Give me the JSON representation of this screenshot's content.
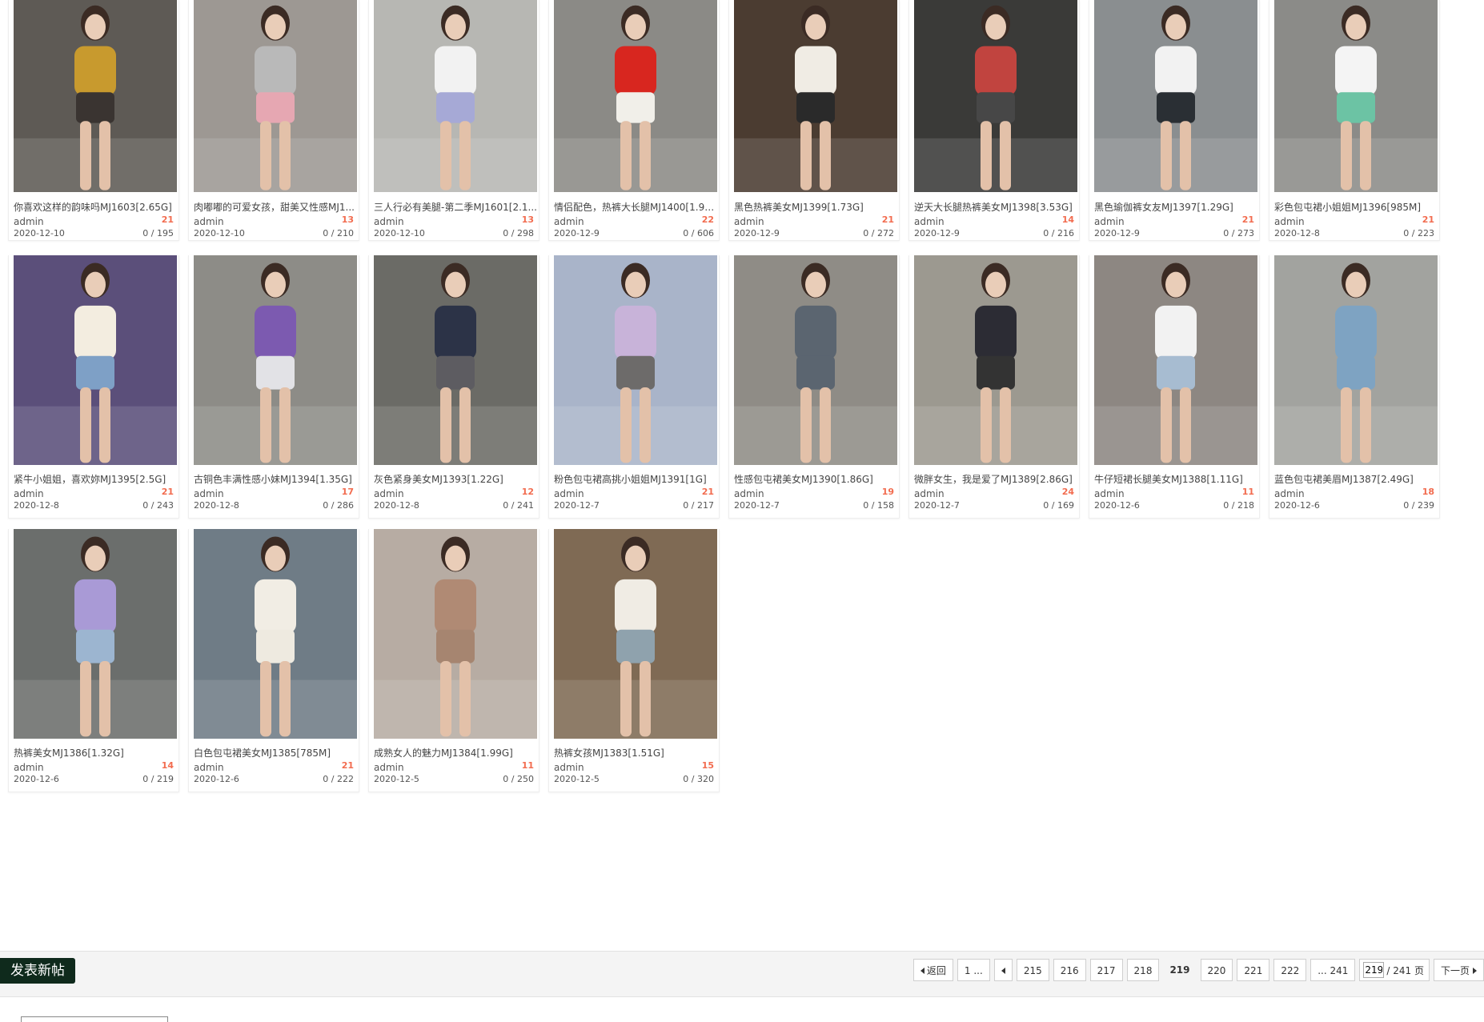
{
  "cards": [
    {
      "title": "你喜欢这样的韵味吗MJ1603[2.65G]",
      "author": "admin",
      "replies": "21",
      "date": "2020-12-10",
      "views": "0 / 195",
      "palette": [
        "#5e5a55",
        "#c89a2e",
        "#3a3431"
      ]
    },
    {
      "title": "肉嘟嘟的可爱女孩，甜美又性感MJ1...",
      "author": "admin",
      "replies": "13",
      "date": "2020-12-10",
      "views": "0 / 210",
      "palette": [
        "#9d9893",
        "#b9b9b9",
        "#e6a7b2"
      ]
    },
    {
      "title": "三人行必有美腿-第二季MJ1601[2.1...",
      "author": "admin",
      "replies": "13",
      "date": "2020-12-10",
      "views": "0 / 298",
      "palette": [
        "#b7b7b3",
        "#f2f2f2",
        "#a6a9d6"
      ]
    },
    {
      "title": "情侣配色，热裤大长腿MJ1400[1.96...",
      "author": "admin",
      "replies": "22",
      "date": "2020-12-9",
      "views": "0 / 606",
      "palette": [
        "#8b8a86",
        "#d8261f",
        "#f1efe9"
      ]
    },
    {
      "title": "黑色热裤美女MJ1399[1.73G]",
      "author": "admin",
      "replies": "21",
      "date": "2020-12-9",
      "views": "0 / 272",
      "palette": [
        "#4b3c31",
        "#f0ece4",
        "#2a2a2a"
      ]
    },
    {
      "title": "逆天大长腿热裤美女MJ1398[3.53G]",
      "author": "admin",
      "replies": "14",
      "date": "2020-12-9",
      "views": "0 / 216",
      "palette": [
        "#3a3a38",
        "#c1443f",
        "#474747"
      ]
    },
    {
      "title": "黑色瑜伽裤女友MJ1397[1.29G]",
      "author": "admin",
      "replies": "21",
      "date": "2020-12-9",
      "views": "0 / 273",
      "palette": [
        "#8a8e90",
        "#f2f2f2",
        "#2a2f34"
      ]
    },
    {
      "title": "彩色包屯裙小姐姐MJ1396[985M]",
      "author": "admin",
      "replies": "21",
      "date": "2020-12-8",
      "views": "0 / 223",
      "palette": [
        "#8b8b88",
        "#f4f4f4",
        "#6cc3a4"
      ]
    },
    {
      "title": "紧牛小姐姐，喜欢妳MJ1395[2.5G]",
      "author": "admin",
      "replies": "21",
      "date": "2020-12-8",
      "views": "0 / 243",
      "palette": [
        "#5b4f7a",
        "#f3ede0",
        "#7ea0c6"
      ]
    },
    {
      "title": "古铜色丰满性感小妹MJ1394[1.35G]",
      "author": "admin",
      "replies": "17",
      "date": "2020-12-8",
      "views": "0 / 286",
      "palette": [
        "#8d8c87",
        "#7c5ab0",
        "#e2e2e6"
      ]
    },
    {
      "title": "灰色紧身美女MJ1393[1.22G]",
      "author": "admin",
      "replies": "12",
      "date": "2020-12-8",
      "views": "0 / 241",
      "palette": [
        "#6b6b66",
        "#2c3347",
        "#5d5c61"
      ]
    },
    {
      "title": "粉色包屯裙高挑小姐姐MJ1391[1G]",
      "author": "admin",
      "replies": "21",
      "date": "2020-12-7",
      "views": "0 / 217",
      "palette": [
        "#a9b4c9",
        "#c8b3d9",
        "#6d6b6a"
      ]
    },
    {
      "title": "性感包屯裙美女MJ1390[1.86G]",
      "author": "admin",
      "replies": "19",
      "date": "2020-12-7",
      "views": "0 / 158",
      "palette": [
        "#8f8c86",
        "#5b6570",
        "#5b6570"
      ]
    },
    {
      "title": "微胖女生，我是爱了MJ1389[2.86G]",
      "author": "admin",
      "replies": "24",
      "date": "2020-12-7",
      "views": "0 / 169",
      "palette": [
        "#9c9990",
        "#2c2c34",
        "#333333"
      ]
    },
    {
      "title": "牛仔短裙长腿美女MJ1388[1.11G]",
      "author": "admin",
      "replies": "11",
      "date": "2020-12-6",
      "views": "0 / 218",
      "palette": [
        "#8d8782",
        "#f2f2f2",
        "#a7bcd1"
      ]
    },
    {
      "title": "蓝色包屯裙美眉MJ1387[2.49G]",
      "author": "admin",
      "replies": "18",
      "date": "2020-12-6",
      "views": "0 / 239",
      "palette": [
        "#a2a39f",
        "#7ea3c2",
        "#7ea3c2"
      ]
    },
    {
      "title": "热裤美女MJ1386[1.32G]",
      "author": "admin",
      "replies": "14",
      "date": "2020-12-6",
      "views": "0 / 219",
      "palette": [
        "#6b6e6c",
        "#a99ad6",
        "#9cb5d0"
      ]
    },
    {
      "title": "白色包屯裙美女MJ1385[785M]",
      "author": "admin",
      "replies": "21",
      "date": "2020-12-6",
      "views": "0 / 222",
      "palette": [
        "#6f7c86",
        "#f1ede4",
        "#eeeae0"
      ]
    },
    {
      "title": "成熟女人的魅力MJ1384[1.99G]",
      "author": "admin",
      "replies": "11",
      "date": "2020-12-5",
      "views": "0 / 250",
      "palette": [
        "#b7aca3",
        "#b08a74",
        "#a68570"
      ]
    },
    {
      "title": "热裤女孩MJ1383[1.51G]",
      "author": "admin",
      "replies": "15",
      "date": "2020-12-5",
      "views": "0 / 320",
      "palette": [
        "#7f6a54",
        "#f0ece4",
        "#8fa2ad"
      ]
    }
  ],
  "bottom": {
    "new_post": "发表新帖",
    "back": "返回",
    "first": "1 ...",
    "pages": [
      "215",
      "216",
      "217",
      "218"
    ],
    "current": "219",
    "pages_after": [
      "220",
      "221",
      "222"
    ],
    "last": "... 241",
    "input_value": "219",
    "total": "/ 241 页",
    "next": "下一页"
  },
  "colors": {
    "accent_red": "#f26c4f",
    "new_post_bg": "#0f2a1c"
  }
}
